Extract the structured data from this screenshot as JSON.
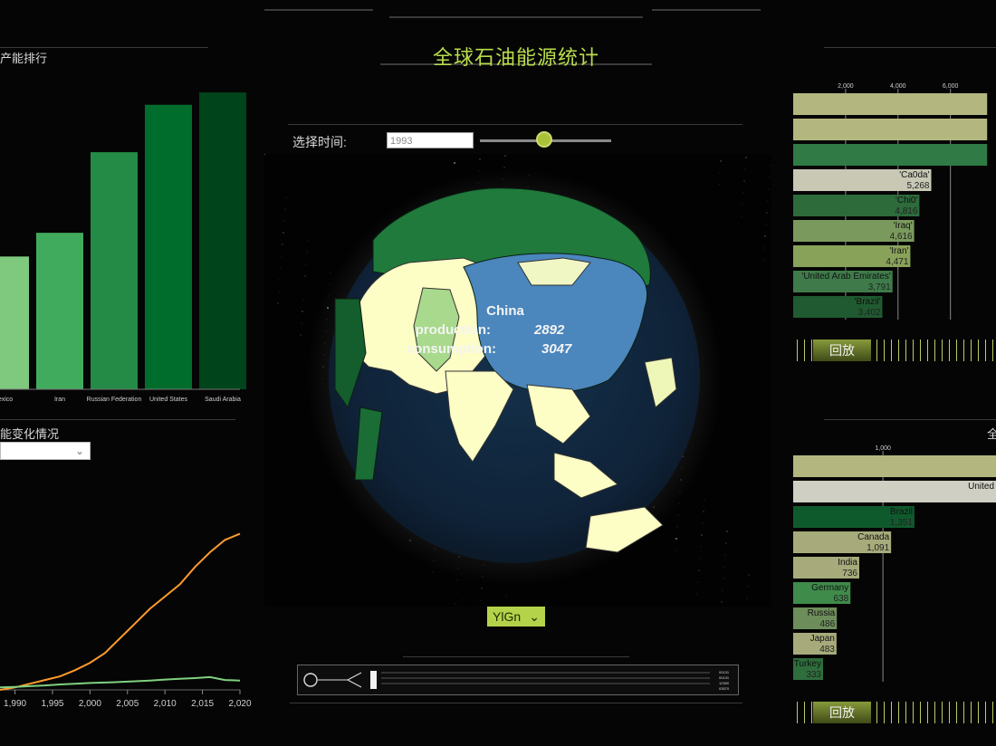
{
  "header": {
    "title": "全球石油能源统计"
  },
  "left_top_panel": {
    "title": "产能排行",
    "chart_data": {
      "type": "bar",
      "categories": [
        "Mexico",
        "Iran",
        "Russian Federation",
        "United States",
        "Saudi Arabia"
      ],
      "tick_labels": [
        "exico",
        "Iran",
        "Russian Federation",
        "United States",
        "Saudi Arabia"
      ],
      "values": [
        2800,
        3300,
        5000,
        6000,
        6260
      ],
      "colors": [
        "#7fc97f",
        "#41ab5d",
        "#238b45",
        "#006d2c",
        "#00441b"
      ]
    }
  },
  "left_bottom_panel": {
    "title": "能变化情况",
    "select": {
      "selected": ""
    },
    "chart_data": {
      "type": "line",
      "x": [
        1988,
        1990,
        1992,
        1994,
        1996,
        1998,
        2000,
        2002,
        2004,
        2006,
        2008,
        2010,
        2012,
        2014,
        2016,
        2018,
        2020
      ],
      "x_tick_labels": [
        "1,990",
        "1,995",
        "2,000",
        "2,005",
        "2,010",
        "2,015",
        "2,020"
      ],
      "series": [
        {
          "values": [
            0,
            10,
            25,
            40,
            55,
            80,
            110,
            150,
            210,
            270,
            330,
            380,
            430,
            500,
            560,
            610,
            635
          ],
          "color": "#ff9a2e"
        },
        {
          "values": [
            10,
            12,
            15,
            18,
            22,
            25,
            28,
            30,
            32,
            35,
            38,
            42,
            45,
            48,
            52,
            40,
            38
          ],
          "color": "#7fd17f"
        }
      ]
    }
  },
  "center": {
    "time_label": "选择时间:",
    "time_input": "1993",
    "globe": {
      "tooltip_country": "China",
      "production_label": "production:",
      "production_value": "2892",
      "consumption_label": "consumption:",
      "consumption_value": "3047"
    },
    "palette": {
      "selected": "YlGn",
      "chevron": "chevron-down-icon"
    },
    "timeline": {
      "icon": "chip-icon",
      "readout": [
        "00131",
        "00131",
        "12300",
        "03570"
      ]
    }
  },
  "right_top_panel": {
    "axis_ticks": [
      "2,000",
      "4,000",
      "6,000"
    ],
    "chart_data": {
      "type": "bar",
      "orientation": "horizontal",
      "categories": [
        "",
        "",
        "",
        "'Ca0da'",
        "'Chi0'",
        "'Iraq'",
        "'Iran'",
        "'United Arab Emirates'",
        "'Brazil'"
      ],
      "values": [
        7400,
        7400,
        7400,
        5268,
        4816,
        4616,
        4471,
        3791,
        3402
      ],
      "value_labels": [
        "",
        "",
        "",
        "5,268",
        "4,816",
        "4,616",
        "4,471",
        "3,791",
        "3,402"
      ],
      "colors": [
        "#b3b77f",
        "#b3b77f",
        "#2f7a45",
        "#c8c8b5",
        "#2d6b3b",
        "#7a9a5d",
        "#89a25a",
        "#3f7b4a",
        "#1f5a30"
      ]
    },
    "playback_label": "回放"
  },
  "right_bottom_panel": {
    "title_fragment": "全",
    "axis_ticks": [
      "1,000"
    ],
    "chart_data": {
      "type": "bar",
      "orientation": "horizontal",
      "categories": [
        "",
        "United",
        "Brazil",
        "Canada",
        "India",
        "Germany",
        "Russia",
        "Japan",
        "Turkey"
      ],
      "values": [
        2300,
        2300,
        1351,
        1091,
        736,
        638,
        486,
        483,
        333
      ],
      "value_labels": [
        "",
        "",
        "1,351",
        "1,091",
        "736",
        "638",
        "486",
        "483",
        "333"
      ],
      "colors": [
        "#b3b77f",
        "#cfcfc3",
        "#0f5a2d",
        "#a7ab7b",
        "#a7ab7b",
        "#3f8b4a",
        "#6d8d5b",
        "#a7ab7b",
        "#2e6d3c"
      ]
    },
    "playback_label": "回放"
  }
}
